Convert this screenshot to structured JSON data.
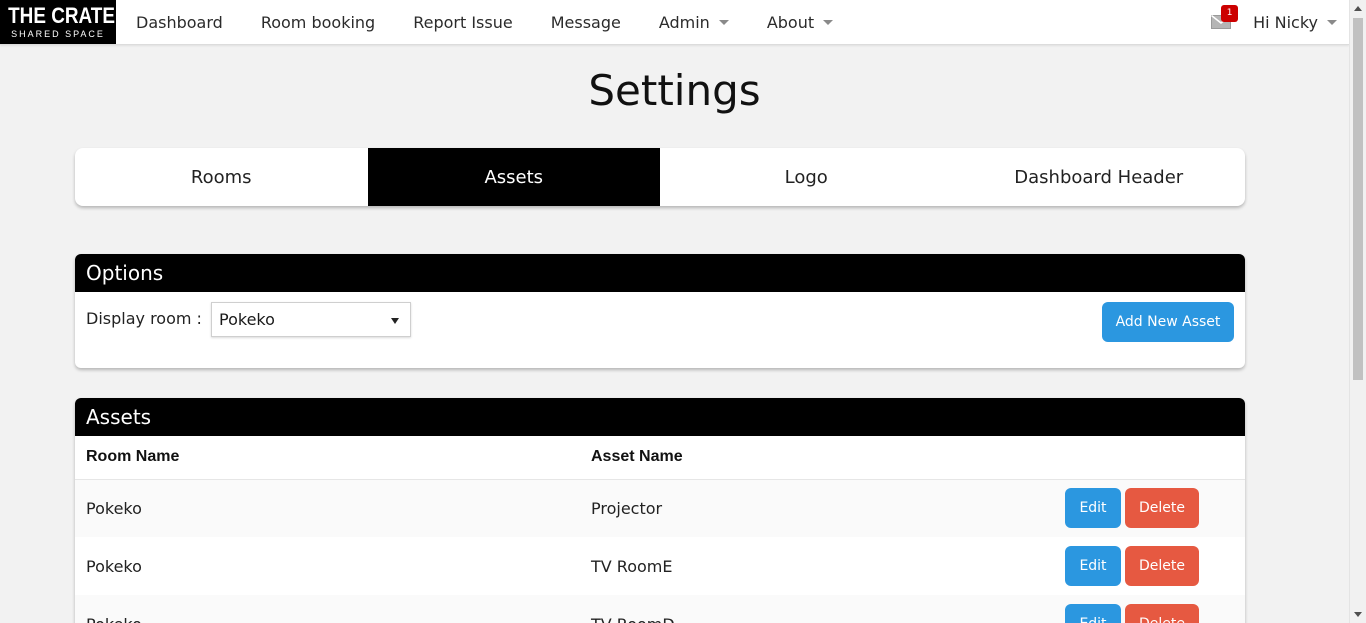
{
  "logo": {
    "main": "THE CRATE",
    "sub": "SHARED SPACE"
  },
  "nav": {
    "items": [
      {
        "label": "Dashboard",
        "dropdown": false
      },
      {
        "label": "Room booking",
        "dropdown": false
      },
      {
        "label": "Report Issue",
        "dropdown": false
      },
      {
        "label": "Message",
        "dropdown": false
      },
      {
        "label": "Admin",
        "dropdown": true
      },
      {
        "label": "About",
        "dropdown": true
      }
    ],
    "mail_badge": "1",
    "user_greeting": "Hi Nicky"
  },
  "page_title": "Settings",
  "tabs": [
    {
      "label": "Rooms",
      "active": false
    },
    {
      "label": "Assets",
      "active": true
    },
    {
      "label": "Logo",
      "active": false
    },
    {
      "label": "Dashboard Header",
      "active": false
    }
  ],
  "options": {
    "heading": "Options",
    "display_room_label": "Display room :",
    "display_room_value": "Pokeko",
    "add_button": "Add New Asset"
  },
  "assets": {
    "heading": "Assets",
    "columns": [
      "Room Name",
      "Asset Name"
    ],
    "rows": [
      {
        "room": "Pokeko",
        "asset": "Projector"
      },
      {
        "room": "Pokeko",
        "asset": "TV RoomE"
      },
      {
        "room": "Pokeko",
        "asset": "TV RoomD"
      }
    ],
    "edit_label": "Edit",
    "delete_label": "Delete"
  },
  "colors": {
    "accent_blue": "#2b97e0",
    "danger_red": "#e65941",
    "header_black": "#000000",
    "badge_red": "#cc0000"
  }
}
